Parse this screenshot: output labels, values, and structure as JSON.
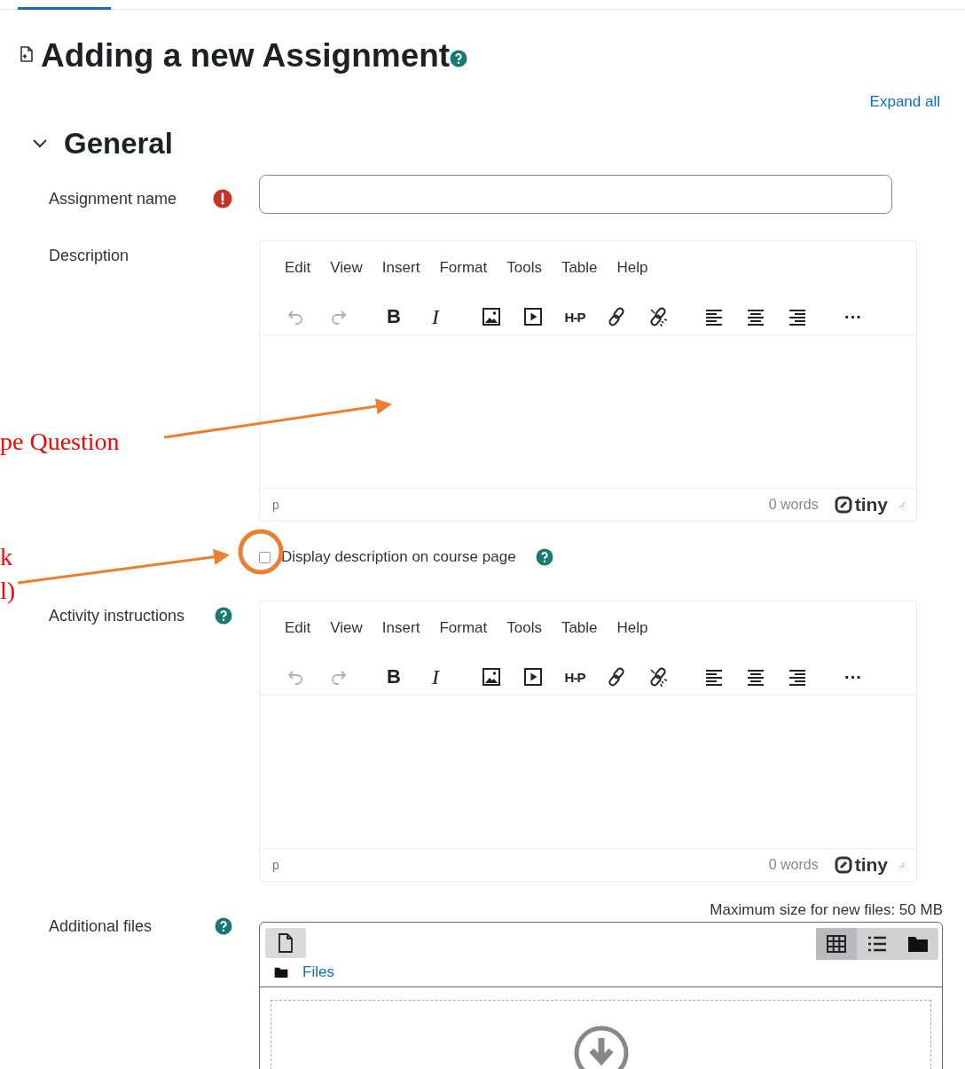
{
  "page": {
    "title": "Adding a new Assignment",
    "expand_all": "Expand all"
  },
  "section": {
    "title": "General",
    "expanded": true
  },
  "fields": [
    {
      "kind": "text",
      "label": "Assignment name",
      "required": true
    },
    {
      "kind": "editor",
      "label": "Description",
      "menu": [
        "Edit",
        "View",
        "Insert",
        "Format",
        "Tools",
        "Table",
        "Help"
      ],
      "toolbar": [
        {
          "kind": "undo",
          "disabled": true
        },
        {
          "kind": "redo",
          "disabled": true
        },
        {
          "kind": "bold",
          "label": "B",
          "disabled": false
        },
        {
          "kind": "italic",
          "label": "I",
          "disabled": false
        },
        {
          "kind": "image",
          "disabled": false
        },
        {
          "kind": "media",
          "disabled": false
        },
        {
          "kind": "h5p",
          "label": "H-P",
          "disabled": false
        },
        {
          "kind": "link",
          "disabled": false
        },
        {
          "kind": "unlink",
          "disabled": false
        },
        {
          "kind": "align-left",
          "disabled": false
        },
        {
          "kind": "align-center",
          "disabled": false
        },
        {
          "kind": "align-right",
          "disabled": false
        },
        {
          "kind": "more",
          "label": "···",
          "disabled": false
        }
      ],
      "path": "p",
      "word_count": "0 words",
      "brand": "tiny"
    },
    {
      "kind": "checkbox",
      "label": "Display description on course page",
      "checked": false,
      "help": true
    },
    {
      "kind": "editor",
      "label": "Activity instructions",
      "help": true,
      "menu": [
        "Edit",
        "View",
        "Insert",
        "Format",
        "Tools",
        "Table",
        "Help"
      ],
      "toolbar": [
        {
          "kind": "undo",
          "disabled": true
        },
        {
          "kind": "redo",
          "disabled": true
        },
        {
          "kind": "bold",
          "label": "B",
          "disabled": false
        },
        {
          "kind": "italic",
          "label": "I",
          "disabled": false
        },
        {
          "kind": "image",
          "disabled": false
        },
        {
          "kind": "media",
          "disabled": false
        },
        {
          "kind": "h5p",
          "label": "H-P",
          "disabled": false
        },
        {
          "kind": "link",
          "disabled": false
        },
        {
          "kind": "unlink",
          "disabled": false
        },
        {
          "kind": "align-left",
          "disabled": false
        },
        {
          "kind": "align-center",
          "disabled": false
        },
        {
          "kind": "align-right",
          "disabled": false
        },
        {
          "kind": "more",
          "label": "···",
          "disabled": false
        }
      ],
      "path": "p",
      "word_count": "0 words",
      "brand": "tiny"
    },
    {
      "kind": "filemanager",
      "label": "Additional files",
      "help": true,
      "max_size": "Maximum size for new files: 50 MB",
      "folder": "Files",
      "view_modes": [
        {
          "selected": true
        },
        {
          "selected": false
        },
        {
          "selected": false
        }
      ]
    }
  ],
  "annotations": [
    {
      "kind": "note",
      "text": "pe Question"
    },
    {
      "kind": "arrow"
    },
    {
      "kind": "note",
      "text": "k"
    },
    {
      "kind": "note",
      "text": "l)"
    },
    {
      "kind": "arrow"
    },
    {
      "kind": "highlight"
    }
  ]
}
